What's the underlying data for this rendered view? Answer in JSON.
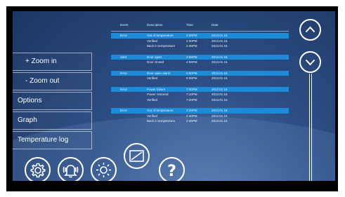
{
  "menu": [
    {
      "label": "+ Zoom in"
    },
    {
      "label": "- Zoom out"
    },
    {
      "label": "Options"
    },
    {
      "label": "Graph"
    },
    {
      "label": "Temperature log"
    }
  ],
  "table": {
    "headers": [
      "Event",
      "Description",
      "Time",
      "Date"
    ],
    "groups": [
      {
        "rows": [
          {
            "event": "Error",
            "description": "Out of temperature",
            "time": "2:28PM",
            "date": "2013.01.16",
            "highlighted": true
          },
          {
            "event": "",
            "description": "Verified",
            "time": "2:30PM",
            "date": "2013.01.16",
            "highlighted": false
          },
          {
            "event": "",
            "description": "Back in temperature",
            "time": "2:35PM",
            "date": "2013.01.16",
            "highlighted": false
          }
        ]
      },
      {
        "rows": [
          {
            "event": "Alert",
            "description": "Door open",
            "time": "4:55PM",
            "date": "2013.01.16",
            "highlighted": true
          },
          {
            "event": "",
            "description": "Door closed",
            "time": "4:56PM",
            "date": "2013.01.16",
            "highlighted": false
          }
        ]
      },
      {
        "rows": [
          {
            "event": "Error",
            "description": "Door open alarm",
            "time": "5:00PM",
            "date": "2013.01.16",
            "highlighted": true
          },
          {
            "event": "",
            "description": "Verified",
            "time": "5:05PM",
            "date": "2013.01.16",
            "highlighted": false
          }
        ]
      },
      {
        "rows": [
          {
            "event": "Error",
            "description": "Power failure",
            "time": "7:00PM",
            "date": "2013.01.16",
            "highlighted": true
          },
          {
            "event": "",
            "description": "Power restored",
            "time": "7:10PM",
            "date": "2013.01.16",
            "highlighted": false
          },
          {
            "event": "",
            "description": "Verified",
            "time": "7:20PM",
            "date": "2013.01.16",
            "highlighted": false
          }
        ]
      },
      {
        "rows": [
          {
            "event": "Error",
            "description": "Out of temperature",
            "time": "2:28PM",
            "date": "2013.01.16",
            "highlighted": true
          },
          {
            "event": "",
            "description": "Verified",
            "time": "2:30PM",
            "date": "2013.01.16",
            "highlighted": false
          },
          {
            "event": "",
            "description": "Back in temperature",
            "time": "2:35PM",
            "date": "2013.01.16",
            "highlighted": false
          }
        ]
      }
    ]
  },
  "icons": {
    "scroll_up": "chevron-up-icon",
    "scroll_down": "chevron-down-icon",
    "settings": "gear-icon",
    "alarm": "bell-icon",
    "brightness": "sun-icon",
    "display": "display-icon",
    "help": "question-mark-icon"
  },
  "help_glyph": "?",
  "colors": {
    "highlight": "#1d8ad8",
    "background": "#2d4f85"
  }
}
